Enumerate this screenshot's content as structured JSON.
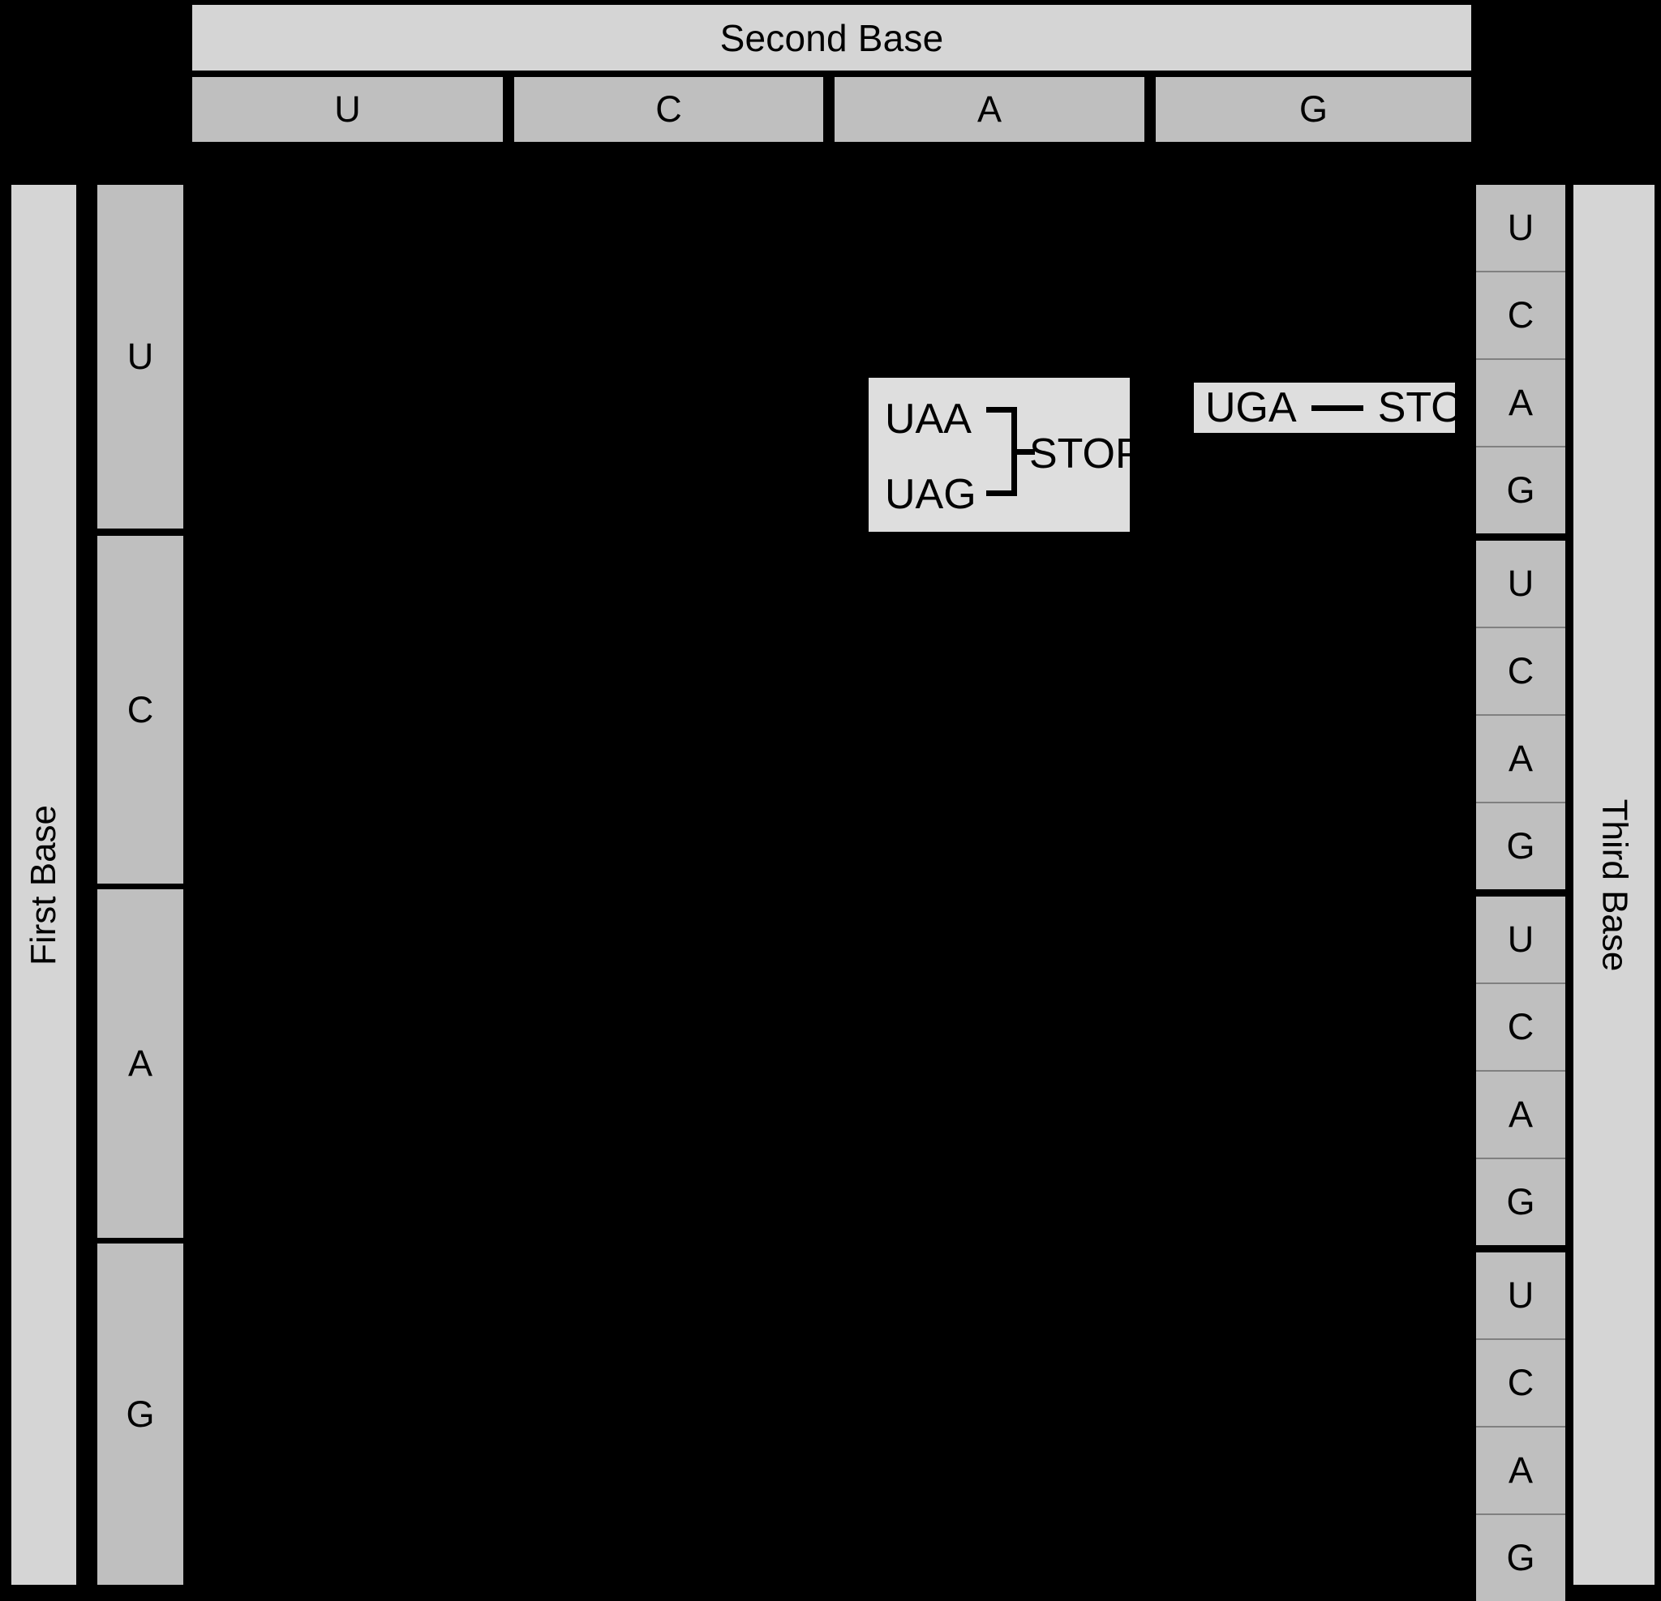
{
  "figure": {
    "type": "genetic-code-codon-table",
    "title_second_base": "Second Base",
    "label_first_base": "First Base",
    "label_third_base": "Third Base"
  },
  "colors": {
    "background": "#000000",
    "band_light": "#d5d5d5",
    "band_base": "#bfbfbf",
    "annotation_box": "#dedede",
    "text": "#000000",
    "divider": "#000000",
    "divider_thin": "#808080"
  },
  "header": {
    "second_base_title": "Second Base",
    "second_base_columns": [
      {
        "label": "U"
      },
      {
        "label": "C"
      },
      {
        "label": "A"
      },
      {
        "label": "G"
      }
    ]
  },
  "left_axis": {
    "label": "First Base",
    "rows": [
      {
        "label": "U"
      },
      {
        "label": "C"
      },
      {
        "label": "A"
      },
      {
        "label": "G"
      }
    ]
  },
  "right_axis": {
    "label": "Third Base",
    "cells": [
      {
        "label": "U",
        "group": "U"
      },
      {
        "label": "C",
        "group": "U"
      },
      {
        "label": "A",
        "group": "U"
      },
      {
        "label": "G",
        "group": "U"
      },
      {
        "label": "U",
        "group": "C"
      },
      {
        "label": "C",
        "group": "C"
      },
      {
        "label": "A",
        "group": "C"
      },
      {
        "label": "G",
        "group": "C"
      },
      {
        "label": "U",
        "group": "A"
      },
      {
        "label": "C",
        "group": "A"
      },
      {
        "label": "A",
        "group": "A"
      },
      {
        "label": "G",
        "group": "A"
      },
      {
        "label": "U",
        "group": "G"
      },
      {
        "label": "C",
        "group": "G"
      },
      {
        "label": "A",
        "group": "G"
      },
      {
        "label": "G",
        "group": "G"
      }
    ]
  },
  "body": {
    "state": "blank",
    "note": "Table body is solid black; no codon/amino-acid entries are rendered."
  },
  "annotations": [
    {
      "id": "stop-uaa-uag",
      "codons": [
        "UAA",
        "UAG"
      ],
      "connector": "bracket",
      "result": "STOP"
    },
    {
      "id": "stop-uga",
      "codons": [
        "UGA"
      ],
      "connector": "dash",
      "result": "STOP"
    }
  ]
}
